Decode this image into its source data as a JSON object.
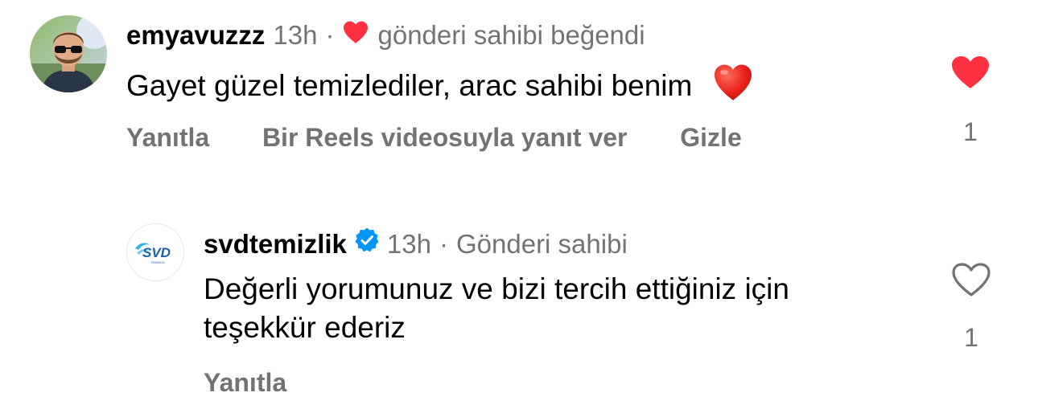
{
  "comments": [
    {
      "username": "emyavuzzz",
      "time": "13h",
      "separator": "·",
      "liked_by_author_text": "gönderi sahibi beğendi",
      "text": "Gayet güzel temizlediler, arac sahibi benim",
      "emoji": "❤️",
      "actions": {
        "reply": "Yanıtla",
        "reels_reply": "Bir Reels videosuyla yanıt ver",
        "hide": "Gizle"
      },
      "liked": true,
      "like_count": "1",
      "like_color": "#ff3040",
      "avatar_icon": "person-with-sunglasses-avatar"
    },
    {
      "username": "svdtemizlik",
      "verified": true,
      "verified_color": "#0095f6",
      "time": "13h",
      "separator": "·",
      "owner_label": "Gönderi sahibi",
      "text_line1": "Değerli yorumunuz ve bizi tercih ettiğiniz için",
      "text_line2": "teşekkür ederiz",
      "actions": {
        "reply": "Yanıtla"
      },
      "liked": false,
      "like_count": "1",
      "avatar_logo_text": "SVD",
      "avatar_logo_subtext": "TEMİZLİK",
      "avatar_icon": "svd-temizlik-logo"
    }
  ]
}
